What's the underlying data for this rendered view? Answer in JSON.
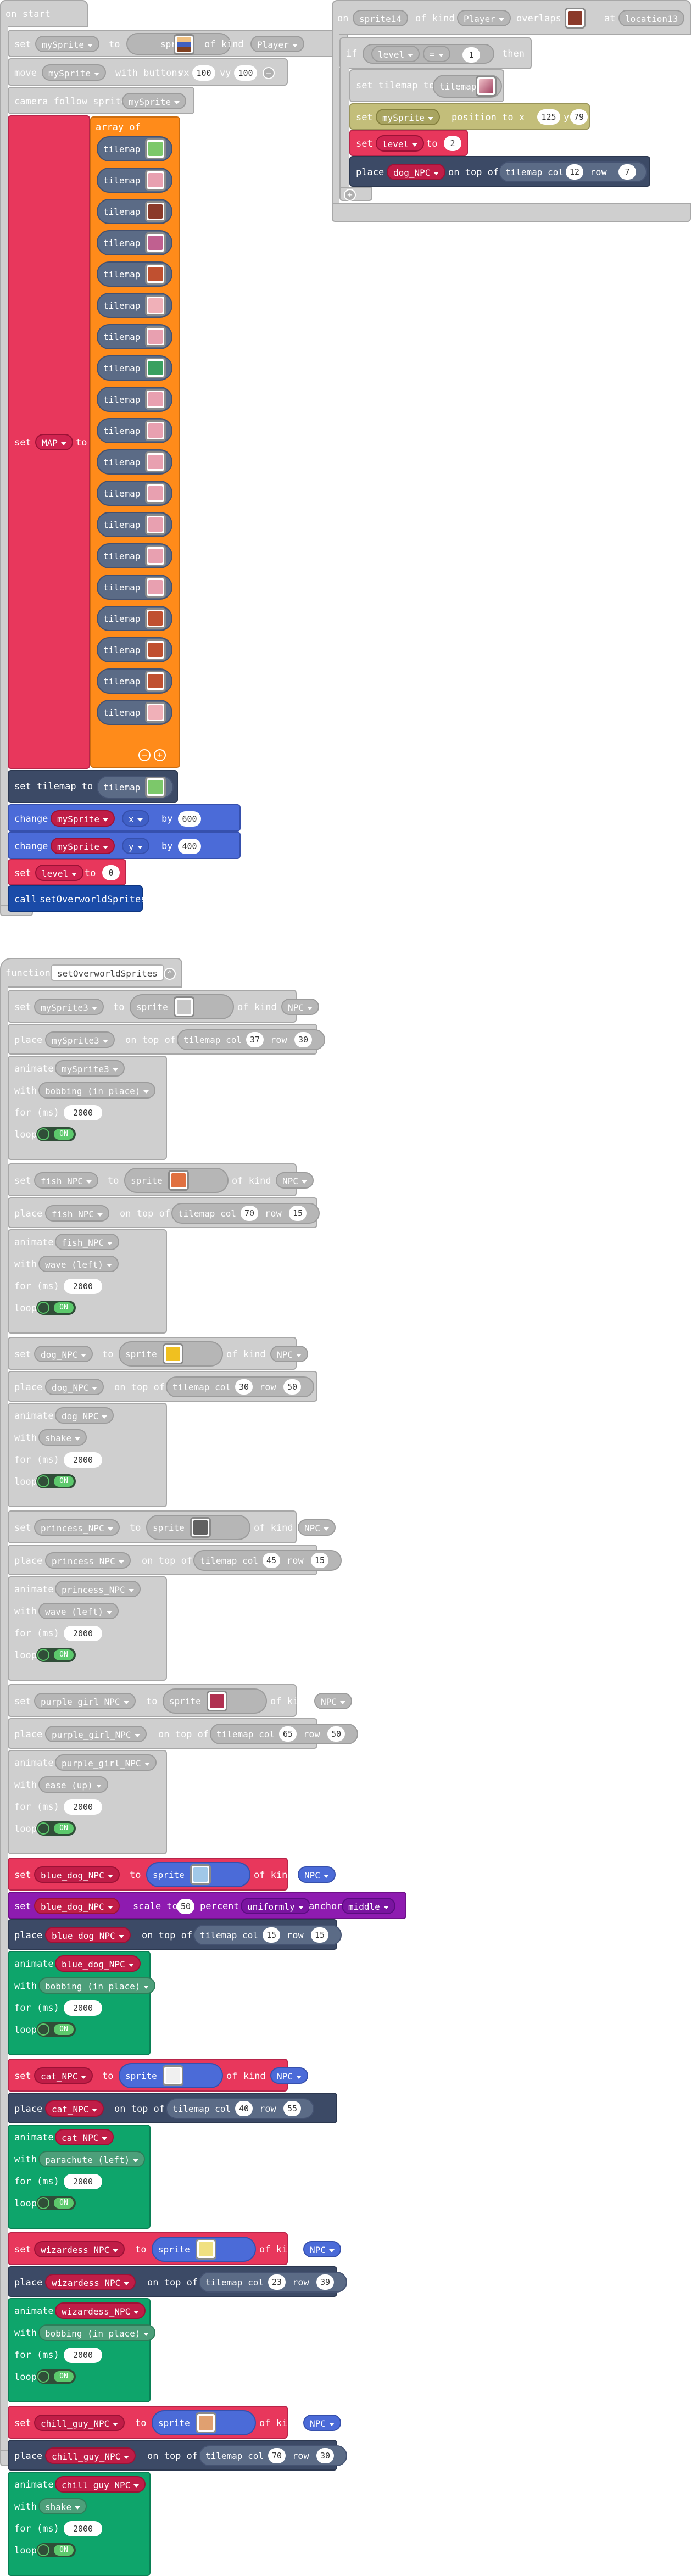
{
  "colors": {
    "gray_block": "#cfcfcf",
    "red_block": "#e8375c",
    "orange_block": "#ff8b1a",
    "blue_block": "#4b6bd8",
    "dark_block": "#3c4a66",
    "purple_block": "#8e1bb0",
    "green_block": "#0ea56b",
    "olive_block": "#c3be7a",
    "toggle_on": "#5cc96c"
  },
  "event_on_start": {
    "title": "on start",
    "set_word": "set",
    "to_word": "to",
    "sprite_word": "sprite",
    "of_kind_word": "of kind",
    "var_mySprite": "mySprite",
    "kind_Player": "Player",
    "move_word": "move",
    "with_buttons_word": "with buttons",
    "vx_word": "vx",
    "vx_value": "100",
    "vy_word": "vy",
    "vy_value": "100",
    "camera_follow_word": "camera follow sprite",
    "set_map_word": "set",
    "map_var": "MAP",
    "array_of_word": "array of",
    "tilemap_word": "tilemap",
    "set_tilemap_word": "set tilemap to",
    "change_word": "change",
    "x_word": "x",
    "y_word": "y",
    "by_word": "by",
    "change_x_value": "600",
    "change_y_value": "400",
    "level_var": "level",
    "level_value": "0",
    "call_word": "call",
    "call_fn": "setOverworldSprites"
  },
  "event_overlap": {
    "on_word": "on",
    "sprite_var": "sprite14",
    "of_kind_word": "of kind",
    "kind_Player": "Player",
    "overlaps_word": "overlaps",
    "at_word": "at",
    "location_var": "location13",
    "if_word": "if",
    "level_var": "level",
    "op": "=",
    "compare_value": "1",
    "then_word": "then",
    "set_tilemap_word": "set tilemap to",
    "tilemap_word": "tilemap",
    "set_word": "set",
    "var_mySprite": "mySprite",
    "position_word": "position to x",
    "x_value": "125",
    "y_word": "y",
    "y_value": "79",
    "to_word": "to",
    "level_new_value": "2",
    "place_word": "place",
    "dog_npc": "dog_NPC",
    "on_top_word": "on top of",
    "tilemap_col_word": "tilemap col",
    "col_value": "12",
    "row_word": "row",
    "row_value": "7"
  },
  "function_block": {
    "function_word": "function",
    "function_name": "setOverworldSprites",
    "set_word": "set",
    "to_word": "to",
    "sprite_word": "sprite",
    "of_kind_word": "of kind",
    "kind_NPC": "NPC",
    "place_word": "place",
    "on_top_word": "on top of",
    "tilemap_col_word": "tilemap col",
    "row_word": "row",
    "animate_word": "animate",
    "with_word": "with",
    "for_ms_word": "for (ms)",
    "ms_value": "2000",
    "loop_word": "loop",
    "on_word": "ON",
    "scale_word": "scale to",
    "percent_word": "percent",
    "uniformly_word": "uniformly",
    "anchor_word": "anchor",
    "middle_word": "middle",
    "npcs": [
      {
        "name": "mySprite3",
        "col": "37",
        "row": "30",
        "anim": "bobbing (in place)"
      },
      {
        "name": "fish_NPC",
        "col": "70",
        "row": "15",
        "anim": "wave (left)"
      },
      {
        "name": "dog_NPC",
        "col": "30",
        "row": "50",
        "anim": "shake"
      },
      {
        "name": "princess_NPC",
        "col": "45",
        "row": "15",
        "anim": "wave (left)"
      },
      {
        "name": "purple_girl_NPC",
        "col": "65",
        "row": "50",
        "anim": "ease (up)"
      },
      {
        "name": "blue_dog_NPC",
        "col": "15",
        "row": "15",
        "anim": "bobbing (in place)",
        "scale": "50"
      },
      {
        "name": "cat_NPC",
        "col": "40",
        "row": "55",
        "anim": "parachute (left)"
      },
      {
        "name": "wizardess_NPC",
        "col": "23",
        "row": "39",
        "anim": "bobbing (in place)"
      },
      {
        "name": "chill_guy_NPC",
        "col": "70",
        "row": "30",
        "anim": "shake"
      }
    ]
  }
}
